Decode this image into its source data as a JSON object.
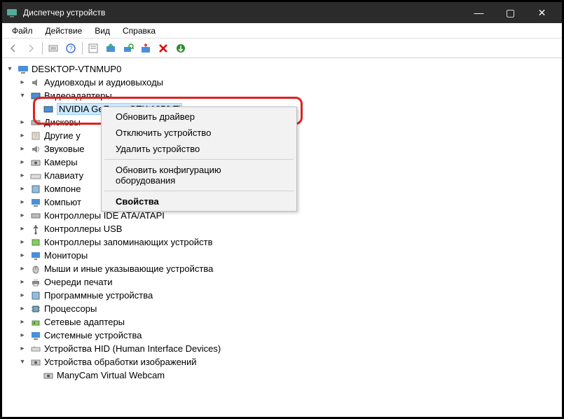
{
  "window": {
    "title": "Диспетчер устройств"
  },
  "menu": {
    "file": "Файл",
    "action": "Действие",
    "view": "Вид",
    "help": "Справка"
  },
  "root": "DESKTOP-VTNMUP0",
  "tree": {
    "audio": "Аудиовходы и аудиовыходы",
    "video": "Видеоадаптеры",
    "gpu": "NVIDIA GeForce GTX 1050 Ti",
    "disk": "Дисковы",
    "other": "Другие у",
    "sound": "Звуковые",
    "cameras": "Камеры",
    "keyboard": "Клавиату",
    "software": "Компоне",
    "computer": "Компьют",
    "ide": "Контроллеры IDE ATA/ATAPI",
    "usb": "Контроллеры USB",
    "storage": "Контроллеры запоминающих устройств",
    "monitors": "Мониторы",
    "mice": "Мыши и иные указывающие устройства",
    "printq": "Очереди печати",
    "progdev": "Программные устройства",
    "cpu": "Процессоры",
    "netadapter": "Сетевые адаптеры",
    "sysdev": "Системные устройства",
    "hid": "Устройства HID (Human Interface Devices)",
    "imaging": "Устройства обработки изображений",
    "webcam": "ManyCam Virtual Webcam"
  },
  "context": {
    "update": "Обновить драйвер",
    "disable": "Отключить устройство",
    "remove": "Удалить устройство",
    "refresh": "Обновить конфигурацию оборудования",
    "props": "Свойства"
  }
}
